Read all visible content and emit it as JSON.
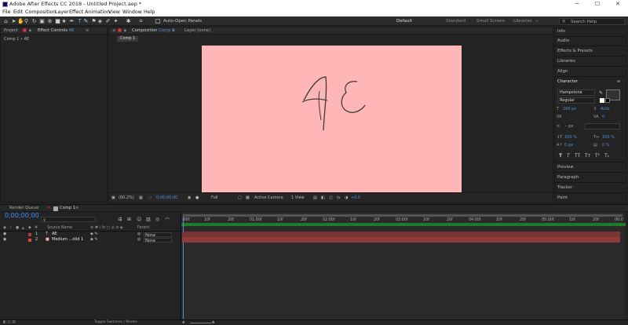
{
  "window": {
    "title": "Adobe After Effects CC 2018 - Untitled Project.aep *",
    "min": "─",
    "max": "☐",
    "close": "✕"
  },
  "menu": [
    "File",
    "Edit",
    "Composition",
    "Layer",
    "Effect",
    "Animation",
    "View",
    "Window",
    "Help"
  ],
  "toolbar": {
    "auto_open": "Auto-Open Panels",
    "workspaces": [
      "Default",
      "Standard",
      "Small Screen",
      "Libraries"
    ],
    "active_workspace": "Default",
    "search_placeholder": "Search Help"
  },
  "left_panel": {
    "tab_project": "Project",
    "tab_effects": "Effect Controls",
    "effects_target": "AE",
    "breadcrumb": "Comp 1 • AE"
  },
  "comp_panel": {
    "tab_comp": "Composition",
    "comp_name": "Comp 1",
    "tab_layer": "Layer (none)",
    "subtab": "Comp 1",
    "canvas_color": "#ffb6b6",
    "canvas_text": "AE"
  },
  "viewer": {
    "zoom": "(60.2%)",
    "timecode": "0;00;00;00",
    "resolution": "Full",
    "camera": "Active Camera",
    "views": "1 View",
    "offset": "+0.0"
  },
  "right_panel": {
    "items_top": [
      "Info",
      "Audio",
      "Effects & Presets",
      "Libraries",
      "Align"
    ],
    "character_title": "Character",
    "font": "Hampstone",
    "style": "Regular",
    "size": "266 px",
    "leading": "Auto",
    "tracking": "0",
    "stroke_unit": "– px",
    "vscale": "100 %",
    "hscale": "100 %",
    "baseline": "0 px",
    "tsume": "0 %",
    "styles": [
      "T",
      "T",
      "TT",
      "Tт",
      "T¹",
      "T₁"
    ],
    "items_bottom": [
      "Preview",
      "Paragraph",
      "Tracker",
      "Paint"
    ]
  },
  "timeline": {
    "tab_render": "Render Queue",
    "tab_comp": "Comp 1",
    "timecode": "0;00;00;00",
    "col_source": "Source Name",
    "col_parent": "Parent",
    "ruler": [
      ":00f",
      "10f",
      "20f",
      "01:00f",
      "10f",
      "20f",
      "02:00f",
      "10f",
      "20f",
      "03:00f",
      "10f",
      "20f",
      "04:00f",
      "10f",
      "20f",
      "05:00f",
      "10f",
      "20f",
      "06:0"
    ],
    "layers": [
      {
        "num": "1",
        "type": "T",
        "name": "AE",
        "parent": "None",
        "label_color": "#b93a3a",
        "bar_color": "#7a3535"
      },
      {
        "num": "2",
        "type": "■",
        "name": "Medium ...olid 1",
        "parent": "None",
        "label_color": "#d44",
        "bar_color": "#8d3b3b"
      }
    ],
    "toggle_label": "Toggle Switches / Modes"
  }
}
